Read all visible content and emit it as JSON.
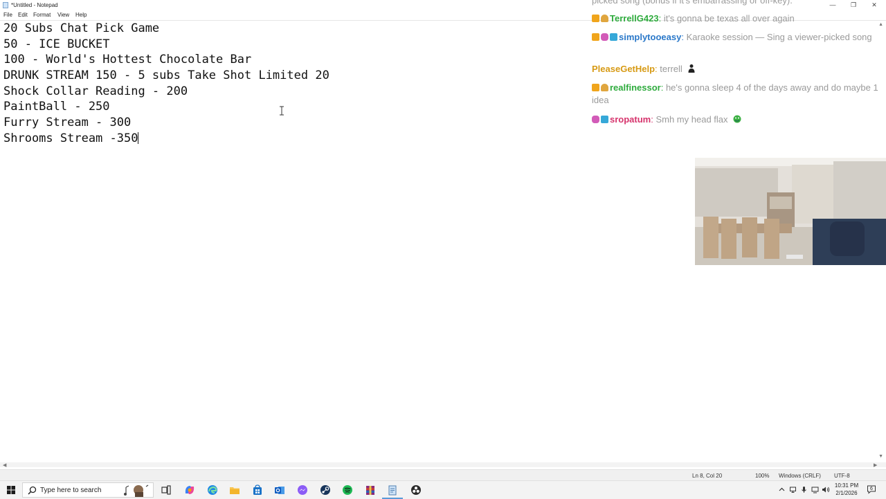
{
  "window": {
    "title": "*Untitled - Notepad",
    "controls": {
      "minimize": "—",
      "restore": "❐",
      "close": "✕"
    }
  },
  "menu": [
    "File",
    "Edit",
    "Format",
    "View",
    "Help"
  ],
  "editor": {
    "lines": [
      "20 Subs Chat Pick Game",
      "50 - ICE BUCKET",
      "100 - World's Hottest Chocolate Bar",
      "DRUNK STREAM 150 - 5 subs Take Shot Limited 20",
      "Shock Collar Reading - 200",
      "PaintBall - 250",
      "Furry Stream - 300",
      "Shrooms Stream -350"
    ]
  },
  "chat": {
    "messages": [
      {
        "user": "",
        "text": "picked song (bonus if it's embarrassing or off-key).",
        "color": "#9a9a9a",
        "badges": []
      },
      {
        "user": "TerrellG423",
        "text": "it's gonna be texas all over again",
        "color": "#2eab3d",
        "badges": [
          "crown-icon",
          "pet-icon"
        ]
      },
      {
        "user": "simplytooeasy",
        "text": "Karaoke session — Sing a viewer-picked song",
        "color": "#2a78c9",
        "badges": [
          "crown-icon",
          "heart-icon",
          "cube-icon"
        ]
      },
      {
        "user": "PleaseGetHelp",
        "text": "terrell",
        "color": "#d79a14",
        "badges": []
      },
      {
        "user": "realfinessor",
        "text": "he's gonna sleep 4 of the days away and do maybe 1 idea",
        "color": "#2eab3d",
        "badges": [
          "crown-icon",
          "pet-icon"
        ]
      },
      {
        "user": "sropatum",
        "text": "Smh my head flax",
        "color": "#d6336c",
        "badges": [
          "heart-icon",
          "cube-icon"
        ]
      }
    ]
  },
  "status": {
    "position": "Ln 8, Col 20",
    "zoom": "100%",
    "line_ending": "Windows (CRLF)",
    "encoding": "UTF-8"
  },
  "taskbar": {
    "search_placeholder": "Type here to search",
    "apps": [
      "start-icon",
      "search-icon",
      "cortana-icon",
      "task-view-icon",
      "copilot-icon",
      "edge-icon",
      "file-explorer-icon",
      "store-icon",
      "outlook-icon",
      "messenger-icon",
      "steam-icon",
      "spotify-icon",
      "winrar-icon",
      "notepad-icon",
      "obs-icon"
    ],
    "clock_time": "10:31 PM",
    "clock_date": "2/1/2026",
    "notification_count": "6"
  }
}
